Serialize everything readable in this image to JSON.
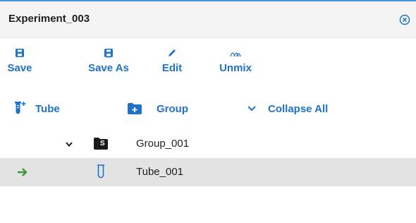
{
  "window": {
    "title": "Experiment_003"
  },
  "toolbar": {
    "save_label": "Save",
    "save_as_label": "Save As",
    "edit_label": "Edit",
    "unmix_label": "Unmix"
  },
  "actions": {
    "tube_label": "Tube",
    "group_label": "Group",
    "collapse_label": "Collapse All"
  },
  "tree": {
    "group_label": "Group_001",
    "group_icon_letter": "S",
    "tube_label": "Tube_001"
  },
  "colors": {
    "accent": "#1e73c8",
    "current_arrow": "#3a9b3a",
    "selected_row": "#e3e3e3",
    "header_bg": "#f4f4f4"
  }
}
